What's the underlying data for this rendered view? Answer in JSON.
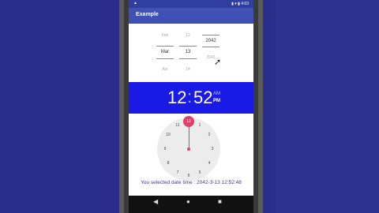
{
  "status_bar": {
    "left_icon": "▲",
    "right_text": "▮ ▾ ▮ 4:03"
  },
  "app": {
    "title": "Example"
  },
  "date_picker": {
    "month": {
      "prev": "Feb",
      "selected": "Mar",
      "next": "Apr"
    },
    "day": {
      "prev": "12",
      "selected": "13",
      "next": "14"
    },
    "year": {
      "prev": "2042",
      "selected": "2043",
      "next": ""
    }
  },
  "time_display": {
    "hour": "12",
    "colon": ":",
    "minute": "52",
    "am_label": "AM",
    "pm_label": "PM",
    "active_period": "PM"
  },
  "clock": {
    "selected_hour": "12",
    "numbers": [
      "1",
      "2",
      "3",
      "4",
      "5",
      "6",
      "7",
      "8",
      "9",
      "10",
      "11"
    ]
  },
  "result_text": "You selected date time : 2042-3-13 12:52:48",
  "nav": {
    "back_icon": "◀",
    "home_icon": "●",
    "recent_icon": "■"
  },
  "colors": {
    "app_bar": "#3f51b5",
    "status_bar": "#303f9f",
    "time_bar": "#1a1ae6",
    "accent": "#e33d6c",
    "result_text": "#3a3aa8"
  }
}
